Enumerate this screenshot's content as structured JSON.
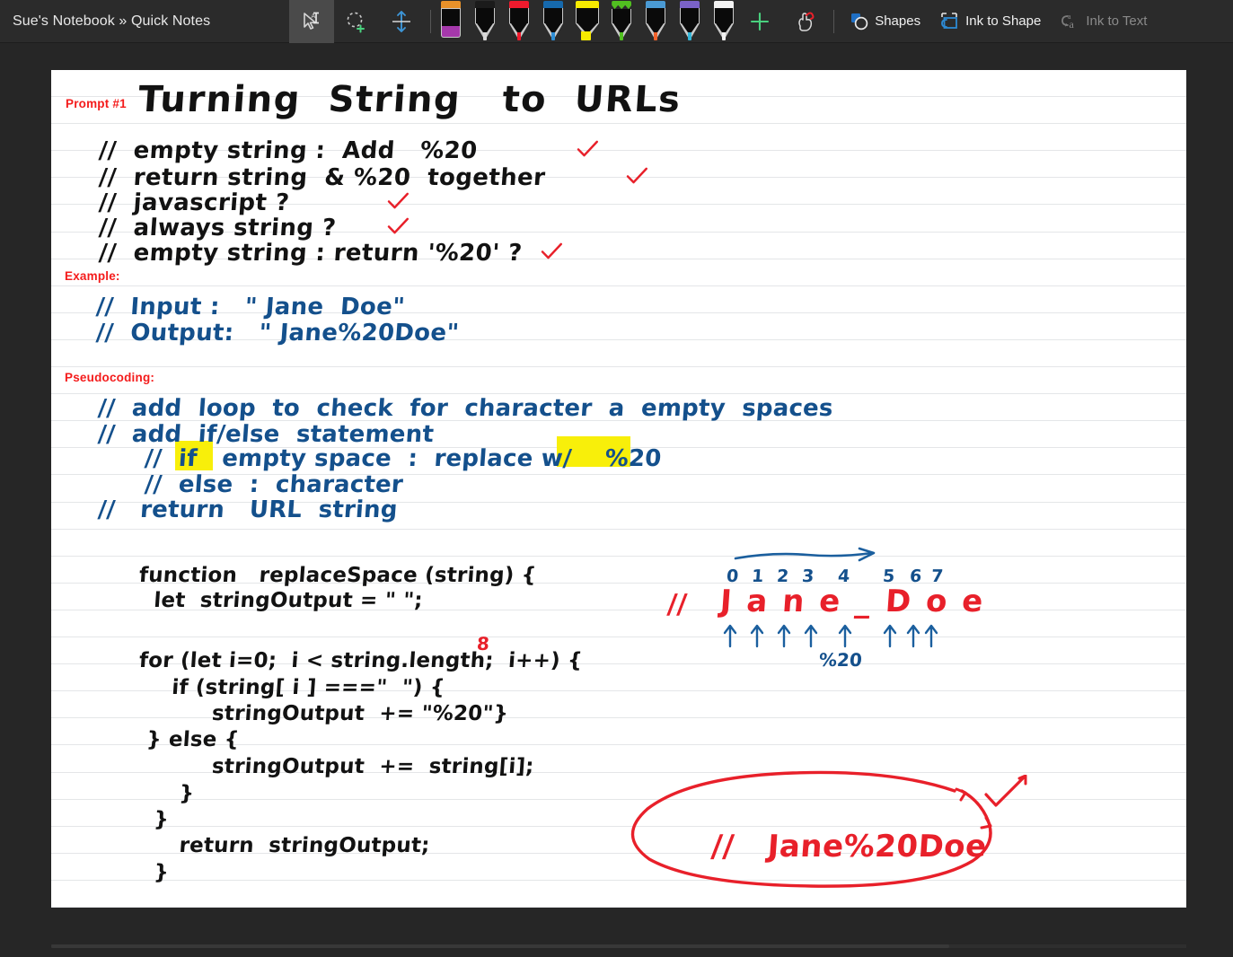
{
  "toolbar": {
    "notebook_title": "Sue's Notebook » Quick Notes",
    "tools": [
      {
        "name": "select-lasso-text-tool",
        "icon": "cursor-text-icon",
        "active": true
      },
      {
        "name": "lasso-add-tool",
        "icon": "lasso-plus-icon",
        "active": false
      },
      {
        "name": "insert-space-tool",
        "icon": "insert-space-icon",
        "active": false
      }
    ],
    "pens": [
      {
        "name": "eraser",
        "icon": "eraser-icon",
        "cap": "#e8912a",
        "nib": "#a538ab",
        "kind": "eraser"
      },
      {
        "name": "pen-black",
        "icon": "pen-icon",
        "cap": "#1b1b1b",
        "nib": "#d8d8d8",
        "kind": "pen"
      },
      {
        "name": "pen-red",
        "icon": "pen-icon",
        "cap": "#ef1a2d",
        "nib": "#ef1a2d",
        "kind": "pen"
      },
      {
        "name": "pen-blue",
        "icon": "pen-icon",
        "cap": "#1669ad",
        "nib": "#2f8fd6",
        "kind": "pen"
      },
      {
        "name": "highlighter-yellow",
        "icon": "highlighter-icon",
        "cap": "#f7ea00",
        "nib": "#f7ea00",
        "kind": "hl"
      },
      {
        "name": "pencil-green",
        "icon": "pencil-icon",
        "cap": "#51c020",
        "nib": "#51c020",
        "kind": "pencil"
      },
      {
        "name": "pen-rainbow",
        "icon": "pen-icon",
        "cap": "#4a9ad4",
        "nib": "#f1622b",
        "kind": "pen"
      },
      {
        "name": "pen-galaxy",
        "icon": "pen-icon",
        "cap": "#7a62c8",
        "nib": "#35b6d8",
        "kind": "pen"
      },
      {
        "name": "pen-white",
        "icon": "pen-icon",
        "cap": "#f2f2f2",
        "nib": "#f2f2f2",
        "kind": "pen"
      }
    ],
    "add_pen_label": "+",
    "actions": [
      {
        "name": "shapes-button",
        "label": "Shapes",
        "icon": "shapes-icon",
        "disabled": false
      },
      {
        "name": "ink-to-shape-button",
        "label": "Ink to Shape",
        "icon": "ink-to-shape-icon",
        "disabled": false
      },
      {
        "name": "ink-to-text-button",
        "label": "Ink to Text",
        "icon": "ink-to-text-icon",
        "disabled": true
      }
    ],
    "touch_draw_label": "touch-draw-icon"
  },
  "page": {
    "section_labels": {
      "prompt": "Prompt #1",
      "example": "Example:",
      "pseudocoding": "Pseudocoding:"
    },
    "title": "Turning  String   to  URLs",
    "requirements": [
      {
        "text": "//  empty string :  Add   %20",
        "check": true
      },
      {
        "text": "//  return string  & %20  together",
        "check": true
      },
      {
        "text": "//  javascript ?",
        "check": true
      },
      {
        "text": "//  always string ?",
        "check": true
      },
      {
        "text": "//  empty string : return '%20' ?",
        "check": true
      }
    ],
    "example_lines": [
      "//  Input :   \" Jane  Doe\"",
      "//  Output:   \" Jane%20Doe\""
    ],
    "pseudocode_lines": [
      "//  add  loop  to  check  for  character  a  empty  spaces",
      "//  add  if/else  statement",
      "//  if   empty space  :  replace w/    %20",
      "//  else  :  character",
      "//   return   URL  string"
    ],
    "pseudocode_highlights": [
      "if",
      "%20"
    ],
    "code_lines": [
      "function   replaceSpace (string) {",
      "  let  stringOutput = \" \";",
      "",
      "for (let i=0;  i < string.length;  i++) {",
      "  if (string[ i ] ===\"  \") {",
      "     stringOutput  += \"%20\"}",
      " } else {",
      "     stringOutput  +=  string[i];",
      "   }",
      "  }",
      "   return  stringOutput;",
      "  }"
    ],
    "code_annotation": "8",
    "index_diagram": {
      "indices": [
        "0",
        "1",
        "2",
        "3",
        "4",
        "5",
        "6",
        "7"
      ],
      "string_prefix": "//",
      "string_text": "J a n e _ D o e",
      "space_token": "%20",
      "arrow_label": "right-arrow"
    },
    "result": {
      "text": "//   Jane%20Doe",
      "circled": true,
      "check": true
    }
  },
  "colors": {
    "toolbar_bg": "#2b2b2b",
    "app_bg": "#262626",
    "page_bg": "#ffffff",
    "rule": "#e4e6e8",
    "ink_black": "#121212",
    "ink_blue": "#14508c",
    "ink_red": "#e8202a",
    "label_red": "#f41c1c",
    "highlight_yellow": "#f8ef0a"
  }
}
